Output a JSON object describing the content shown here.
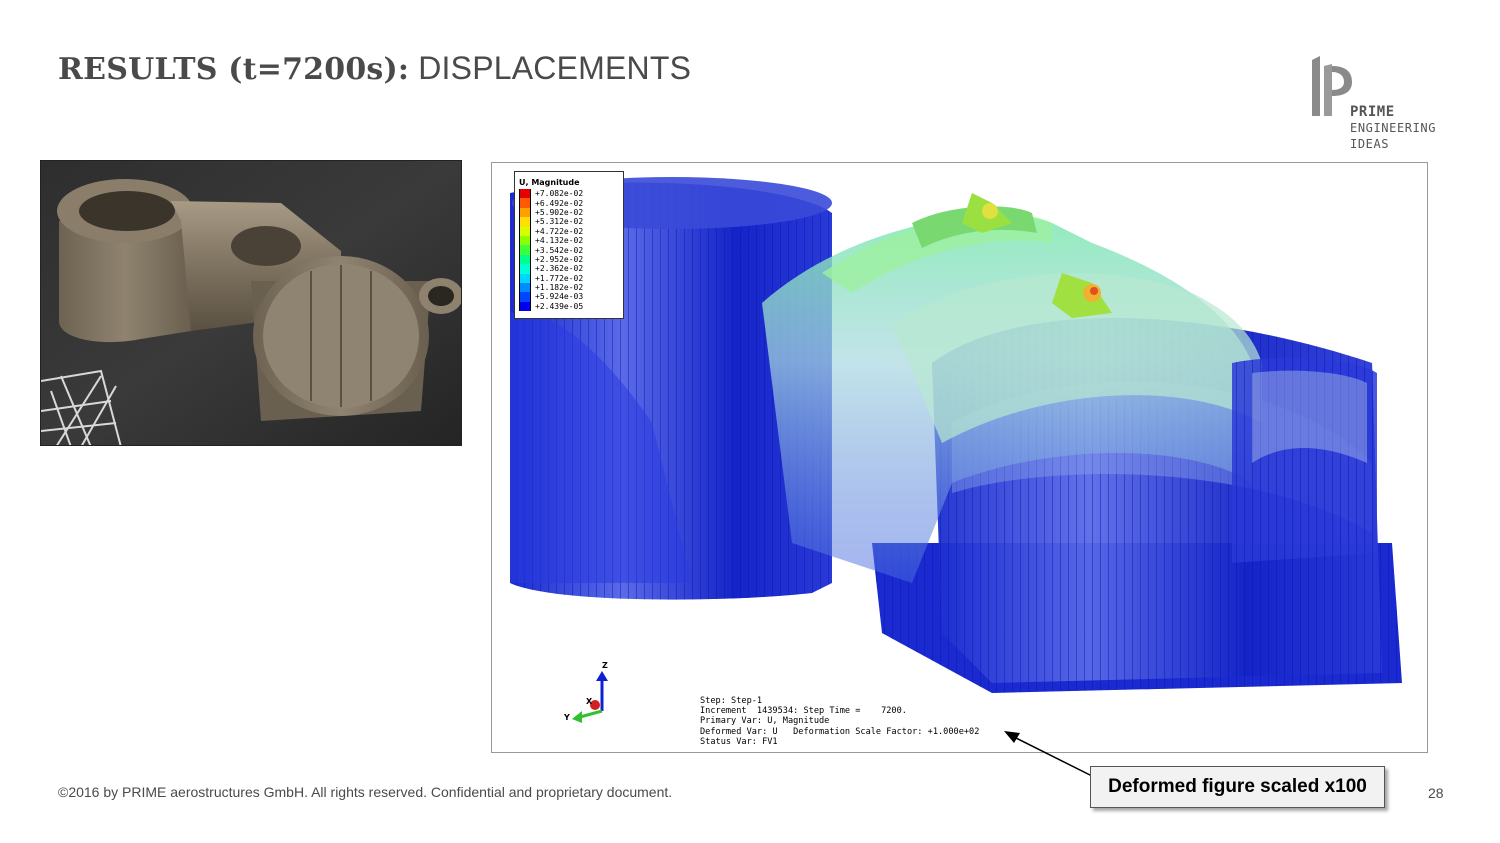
{
  "header": {
    "title_bold": "RESULTS (t=7200s):",
    "title_light": "DISPLACEMENTS"
  },
  "logo": {
    "mark": "1P",
    "line1": "PRIME",
    "line2": "ENGINEERING",
    "line3": "IDEAS"
  },
  "legend": {
    "title": "U, Magnitude",
    "entries": [
      {
        "value": "+7.082e-02",
        "color": "#e60000"
      },
      {
        "value": "+6.492e-02",
        "color": "#ff5a00"
      },
      {
        "value": "+5.902e-02",
        "color": "#ff9f00"
      },
      {
        "value": "+5.312e-02",
        "color": "#ffe000"
      },
      {
        "value": "+4.722e-02",
        "color": "#d5ff00"
      },
      {
        "value": "+4.132e-02",
        "color": "#8cff00"
      },
      {
        "value": "+3.542e-02",
        "color": "#3dff3d"
      },
      {
        "value": "+2.952e-02",
        "color": "#00ff8c"
      },
      {
        "value": "+2.362e-02",
        "color": "#00ffd5"
      },
      {
        "value": "+1.772e-02",
        "color": "#00d5ff"
      },
      {
        "value": "+1.182e-02",
        "color": "#008cff"
      },
      {
        "value": "+5.924e-03",
        "color": "#0046ff"
      },
      {
        "value": "+2.439e-05",
        "color": "#0000ee"
      }
    ]
  },
  "triad": {
    "z": "Z",
    "x": "X",
    "y": "Y"
  },
  "status": {
    "step": "Step: Step-1",
    "increment": "Increment  1439534: Step Time =    7200.",
    "primary": "Primary Var: U, Magnitude",
    "deformed": "Deformed Var: U   Deformation Scale Factor: +1.000e+02",
    "statusvar": "Status Var: FV1"
  },
  "callout": {
    "label": "Deformed figure scaled x100"
  },
  "footer": {
    "copyright": "©2016 by PRIME aerostructures GmbH. All rights reserved. Confidential and proprietary document.",
    "page_number": "28"
  }
}
